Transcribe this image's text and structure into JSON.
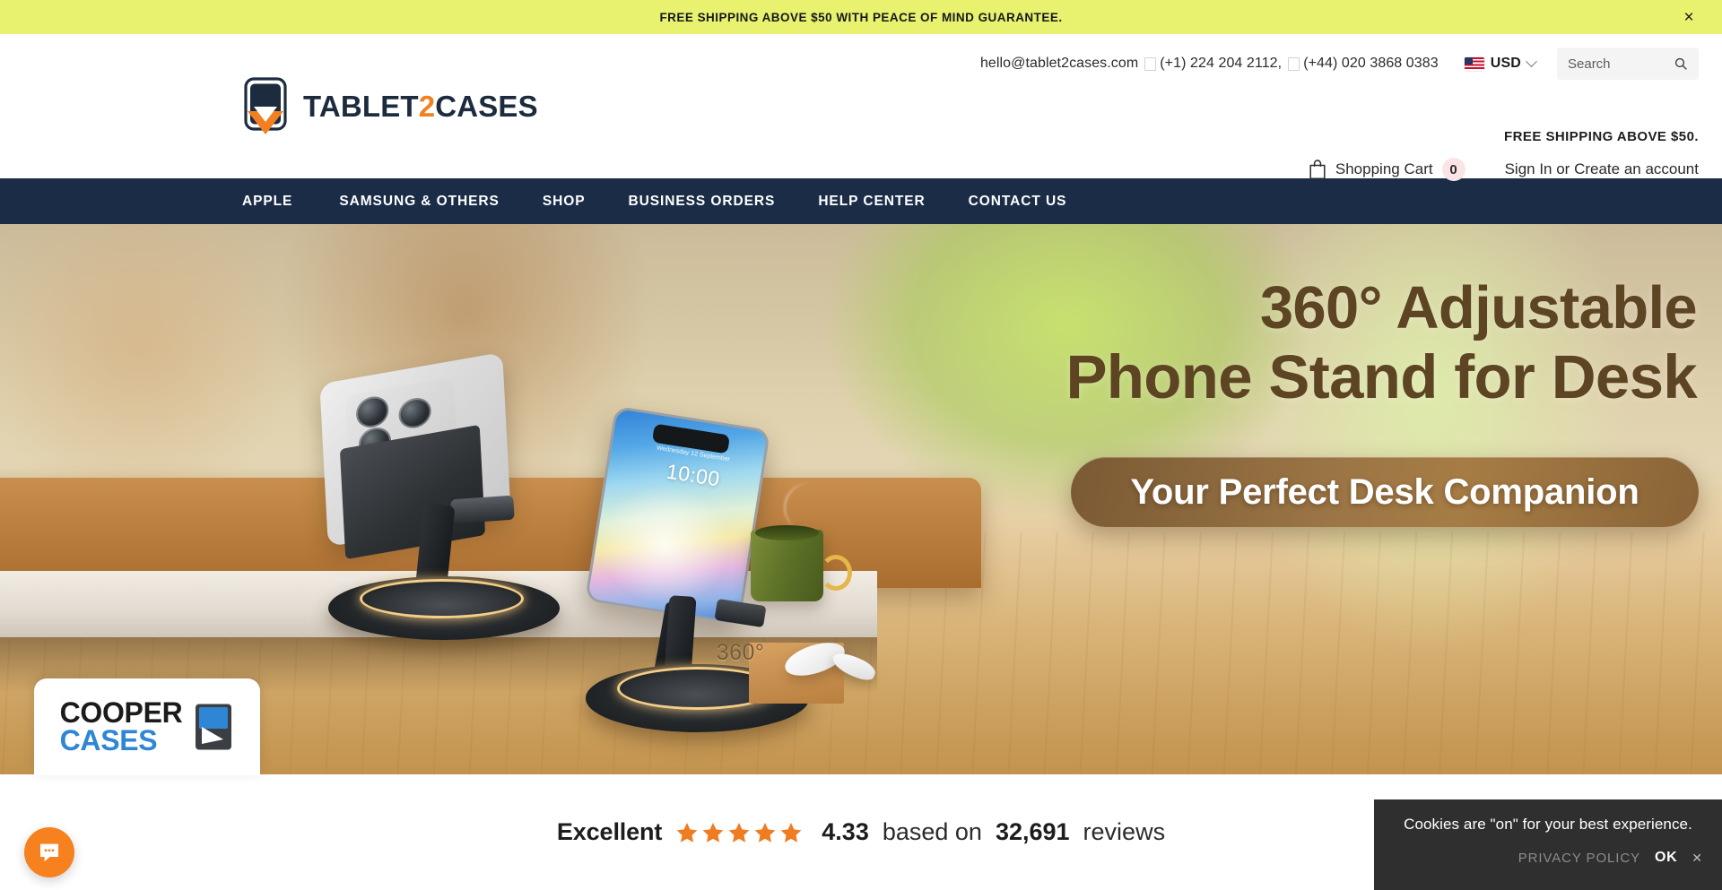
{
  "announcement": {
    "text": "FREE SHIPPING ABOVE $50 WITH PEACE OF MIND GUARANTEE.",
    "close_label": "×",
    "bg_color": "#e8f26e"
  },
  "topbar": {
    "email": "hello@tablet2cases.com",
    "phone_us": "(+1) 224 204 2112,",
    "phone_uk": "(+44) 020 3868 0383",
    "currency": "USD",
    "currency_flag": "us-flag-icon",
    "search_placeholder": "Search",
    "search_value": ""
  },
  "logo": {
    "text_1": "TABLET",
    "accent": "2",
    "text_2": "CASES",
    "accent_color": "#f28020",
    "dark_color": "#1d2b3f"
  },
  "header_right": {
    "shipping_note": "FREE SHIPPING ABOVE $50.",
    "cart_label": "Shopping Cart",
    "cart_count": "0",
    "account": "Sign In or Create an account"
  },
  "nav": {
    "items": [
      {
        "label": "APPLE"
      },
      {
        "label": "SAMSUNG & OTHERS"
      },
      {
        "label": "SHOP"
      },
      {
        "label": "BUSINESS ORDERS"
      },
      {
        "label": "HELP CENTER"
      },
      {
        "label": "CONTACT US"
      }
    ],
    "bg_color": "#1b2c47"
  },
  "hero": {
    "headline_line1": "360° Adjustable",
    "headline_line2": "Phone Stand for Desk",
    "cta": "Your Perfect Desk Companion",
    "product_label": "360°",
    "phone_clock": "10:00",
    "phone_date": "Wednesday 12 September",
    "headline_color": "#5d4422"
  },
  "cooper_badge": {
    "line1": "COOPER",
    "line2": "CASES",
    "line1_color": "#1b1b1b",
    "line2_color": "#2f86d4"
  },
  "reviews": {
    "rating_word": "Excellent",
    "stars": 5,
    "score": "4.33",
    "mid_text": "based on",
    "count": "32,691",
    "tail_text": "reviews",
    "star_color": "#f07c21"
  },
  "chat": {
    "icon": "chat-bubble-icon",
    "bg_color": "#f7801f"
  },
  "cookie": {
    "message": "Cookies are \"on\" for your best experience.",
    "privacy_label": "PRIVACY POLICY",
    "ok_label": "OK",
    "close_label": "✕"
  }
}
